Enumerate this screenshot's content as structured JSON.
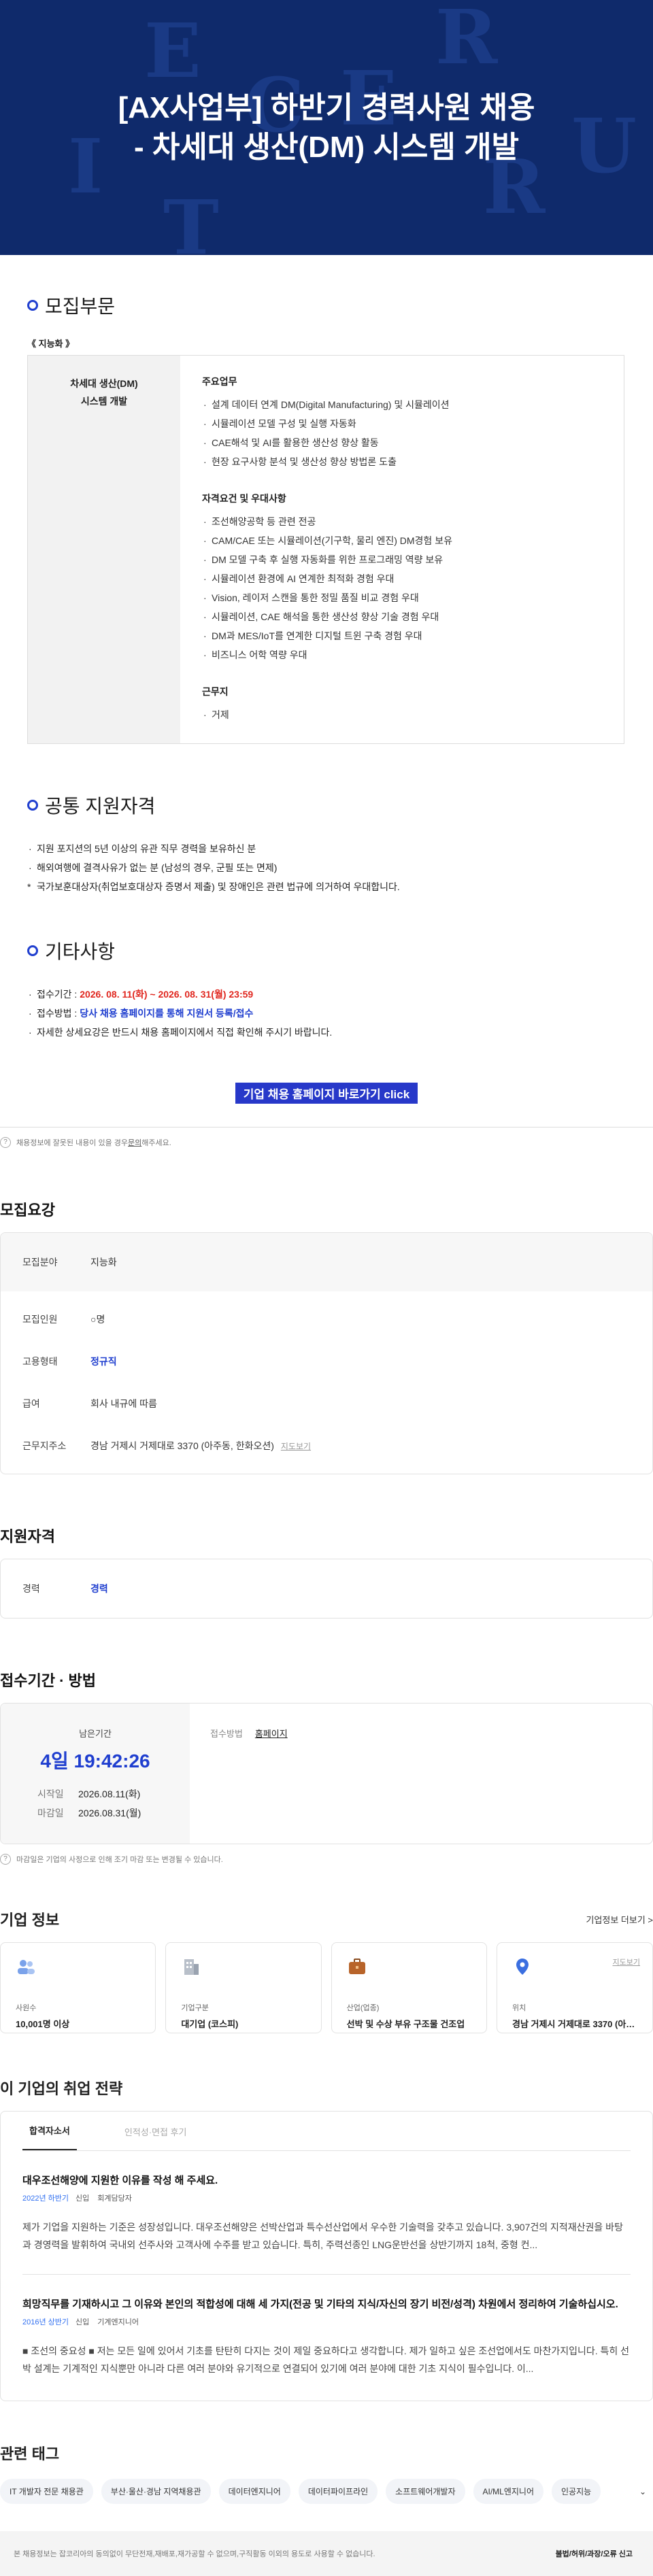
{
  "hero": {
    "title_line1": "[AX사업부] 하반기 경력사원 채용",
    "title_line2": "- 차세대 생산(DM) 시스템 개발",
    "bg_letters": [
      "E",
      "R",
      "E",
      "C",
      "I",
      "T",
      "U",
      "R"
    ]
  },
  "recruit": {
    "heading": "모집부문",
    "category": "《 지능화 》",
    "job_title_line1": "차세대 생산(DM)",
    "job_title_line2": "시스템 개발",
    "duties_title": "주요업무",
    "duties": [
      "설계 데이터 연계 DM(Digital Manufacturing) 및 시뮬레이션",
      "시뮬레이션 모델 구성 및 실행 자동화",
      "CAE해석 및 AI를 활용한 생산성 향상 활동",
      "현장 요구사항 분석 및 생산성 향상 방법론 도출"
    ],
    "quals_title": "자격요건 및 우대사항",
    "quals": [
      "조선해양공학 등 관련 전공",
      "CAM/CAE 또는 시뮬레이션(기구학, 물리 엔진) DM경험 보유",
      "DM 모델 구축 후 실행 자동화를 위한 프로그래밍 역량 보유",
      "시뮬레이션 환경에 AI 연계한 최적화 경험 우대",
      "Vision, 레이저 스캔을 통한 정밀 품질 비교 경험 우대",
      "시뮬레이션, CAE 해석을 통한 생산성 향상 기술 경험 우대",
      "DM과 MES/IoT를 연계한 디지털 트윈 구축 경험 우대",
      "비즈니스 어학 역량 우대"
    ],
    "location_title": "근무지",
    "location": "거제"
  },
  "common": {
    "heading": "공통 지원자격",
    "items": [
      "지원 포지션의 5년 이상의 유관 직무 경력을 보유하신 분",
      "해외여행에 결격사유가 없는 분 (남성의 경우, 군필 또는 면제)"
    ],
    "note": "국가보훈대상자(취업보호대상자 증명서 제출) 및 장애인은 관련 법규에 의거하여 우대합니다."
  },
  "etc": {
    "heading": "기타사항",
    "period_label": "접수기간 : ",
    "period_value": "2026. 08. 11(화) ~ 2026. 08. 31(월) 23:59",
    "method_label": "접수방법 : ",
    "method_value": "당사 채용 홈페이지를 통해 지원서 등록/접수",
    "detail": "자세한 상세요강은 반드시 채용 홈페이지에서 직접 확인해 주시기 바랍니다.",
    "cta": "기업 채용 홈페이지 바로가기 click"
  },
  "help_note": {
    "text": "채용정보에 잘못된 내용이 있을 경우 ",
    "link": "문의",
    "suffix": "해주세요."
  },
  "summary": {
    "heading": "모집요강",
    "rows": [
      {
        "k": "모집분야",
        "v": "지능화"
      },
      {
        "k": "모집인원",
        "v": "○명"
      },
      {
        "k": "고용형태",
        "v": "정규직"
      },
      {
        "k": "급여",
        "v": "회사 내규에 따름"
      },
      {
        "k": "근무지주소",
        "v": "경남 거제시 거제대로 3370 (아주동, 한화오션)"
      }
    ],
    "map_link": "지도보기"
  },
  "qualification": {
    "heading": "지원자격",
    "k": "경력",
    "v": "경력"
  },
  "apply": {
    "heading": "접수기간 · 방법",
    "remaining_label": "남은기간",
    "remaining": "4일 19:42:26",
    "start_label": "시작일",
    "start": "2026.08.11(화)",
    "end_label": "마감일",
    "end": "2026.08.31(월)",
    "method_label": "접수방법",
    "method": "홈페이지",
    "note": "마감일은 기업의 사정으로 인해 조기 마감 또는 변경될 수 있습니다."
  },
  "company": {
    "heading": "기업 정보",
    "more": "기업정보 더보기 >",
    "cards": [
      {
        "icon": "people-icon",
        "label": "사원수",
        "value": "10,001명 이상"
      },
      {
        "icon": "building-icon",
        "label": "기업구분",
        "value": "대기업 (코스피)"
      },
      {
        "icon": "briefcase-icon",
        "label": "산업(업종)",
        "value": "선박 및 수상 부유 구조물 건조업"
      },
      {
        "icon": "pin-icon",
        "label": "위치",
        "value": "경남 거제시 거제대로 3370 (아주동, 한화오션)",
        "map": "지도보기"
      }
    ]
  },
  "strategy": {
    "heading": "이 기업의 취업 전략",
    "tabs": [
      "합격자소서",
      "인적성·면접 후기"
    ],
    "essays": [
      {
        "q": "대우조선해양에 지원한 이유를 작성 해 주세요.",
        "year": "2022년 하반기",
        "type": "신입",
        "role": "회계담당자",
        "body": "제가 기업을 지원하는 기준은 성장성입니다. 대우조선해양은 선박산업과 특수선산업에서 우수한 기술력을 갖추고 있습니다. 3,907건의 지적재산권을 바탕과 경영력을 발휘하여 국내외 선주사와 고객사에 수주를 받고 있습니다. 특히, 주력선종인 LNG운반선을 상반기까지 18척, 중형 컨..."
      },
      {
        "q": "희망직무를 기재하시고 그 이유와 본인의 적합성에 대해 세 가지(전공 및 기타의 지식/자신의 장기 비전/성격) 차원에서 정리하여 기술하십시오.",
        "year": "2016년 상반기",
        "type": "신입",
        "role": "기계엔지니어",
        "body": "■ 조선의 중요성 ■ 저는 모든 일에 있어서 기초를 탄탄히 다지는 것이 제일 중요하다고 생각합니다. 제가 일하고 싶은 조선업에서도 마찬가지입니다. 특히 선박 설계는 기계적인 지식뿐만 아니라 다른 여러 분야와 유기적으로 연결되어 있기에 여러 분야에 대한 기초 지식이 필수입니다. 이..."
      }
    ]
  },
  "tags": {
    "heading": "관련 태그",
    "items": [
      "IT 개발자 전문 채용관",
      "부산·울산·경남 지역채용관",
      "데이터엔지니어",
      "데이터파이프라인",
      "소프트웨어개발자",
      "AI/ML엔지니어",
      "인공지능"
    ]
  },
  "footer": {
    "text": "본 채용정보는 잡코리아의 동의없이 무단전재,재배포,재가공할 수 없으며,구직활동 이외의 용도로 사용할 수 없습니다.",
    "report": "불법/허위/과장/오류 신고"
  }
}
